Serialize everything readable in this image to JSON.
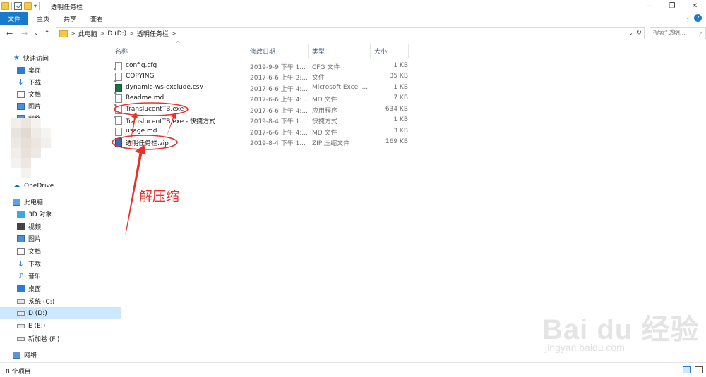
{
  "window": {
    "title": "透明任务栏",
    "minimize_glyph": "—",
    "maximize_glyph": "❐",
    "close_glyph": "✕"
  },
  "ribbon": {
    "tabs": [
      "文件",
      "主页",
      "共享",
      "查看"
    ],
    "expand_glyph": "⌄",
    "help_glyph": "?"
  },
  "address": {
    "back_glyph": "←",
    "forward_glyph": "→",
    "recent_glyph": "⌄",
    "up_glyph": "↑",
    "crumbs": [
      "此电脑",
      "D (D:)",
      "透明任务栏"
    ],
    "separator": ">",
    "refresh_glyph": "↻",
    "dropdown_glyph": "⌄"
  },
  "search": {
    "placeholder": "搜索\"透明...",
    "icon": "search-icon"
  },
  "nav": {
    "quick_access": "快速访问",
    "quick_items": [
      "桌面",
      "下载",
      "文档",
      "图片",
      "网络"
    ],
    "pin_glyph": "✦",
    "onedrive": "OneDrive",
    "this_pc": "此电脑",
    "pc_items": [
      "3D 对象",
      "视频",
      "图片",
      "文档",
      "下载",
      "音乐",
      "桌面"
    ],
    "drives": [
      "系统 (C:)",
      "D (D:)",
      "E (E:)",
      "新加卷 (F:)"
    ],
    "network": "网络"
  },
  "columns": {
    "name": "名称",
    "date": "修改日期",
    "type": "类型",
    "size": "大小",
    "sort_glyph": "^"
  },
  "files": [
    {
      "name": "config.cfg",
      "date": "2019-9-9 下午 1...",
      "type": "CFG 文件",
      "size": "1 KB",
      "icon": "plain"
    },
    {
      "name": "COPYING",
      "date": "2017-6-6 上午 2:...",
      "type": "文件",
      "size": "35 KB",
      "icon": "plain"
    },
    {
      "name": "dynamic-ws-exclude.csv",
      "date": "2017-6-6 上午 4:...",
      "type": "Microsoft Excel ...",
      "size": "1 KB",
      "icon": "xls"
    },
    {
      "name": "Readme.md",
      "date": "2017-6-6 上午 4:...",
      "type": "MD 文件",
      "size": "7 KB",
      "icon": "plain"
    },
    {
      "name": "TranslucentTB.exe",
      "date": "2017-6-6 上午 4:...",
      "type": "应用程序",
      "size": "634 KB",
      "icon": "exe"
    },
    {
      "name": "TranslucentTB.exe - 快捷方式",
      "date": "2019-8-4 下午 1...",
      "type": "快捷方式",
      "size": "1 KB",
      "icon": "exe"
    },
    {
      "name": "usage.md",
      "date": "2017-6-6 上午 4:...",
      "type": "MD 文件",
      "size": "3 KB",
      "icon": "plain"
    },
    {
      "name": "透明任务栏.zip",
      "date": "2019-8-4 下午 1...",
      "type": "ZIP 压缩文件",
      "size": "169 KB",
      "icon": "zip"
    }
  ],
  "status": {
    "count": "8 个项目"
  },
  "annotation": {
    "text": "解压缩",
    "color": "#e8312a"
  },
  "watermark": {
    "logo": "Bai du 经验",
    "sub": "jingyan.baidu.com"
  }
}
